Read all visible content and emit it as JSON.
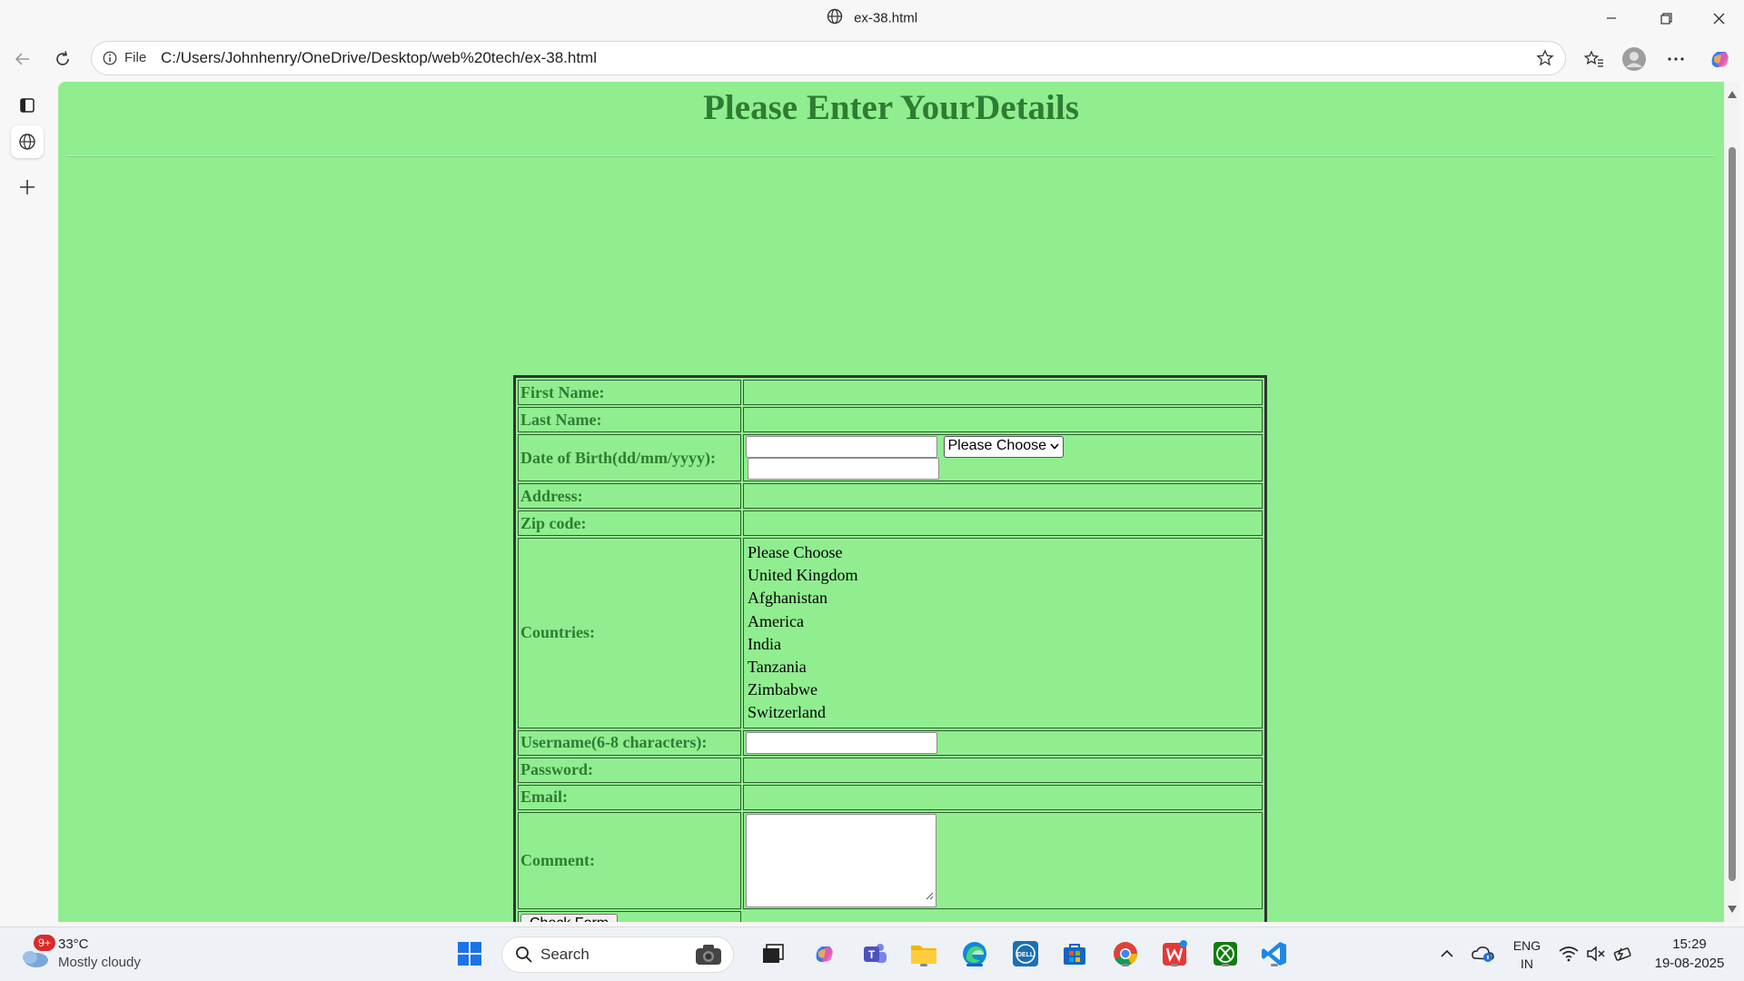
{
  "window": {
    "title": "ex-38.html"
  },
  "address_bar": {
    "protocol_label": "File",
    "url": "C:/Users/Johnhenry/OneDrive/Desktop/web%20tech/ex-38.html"
  },
  "page": {
    "heading": "Please Enter YourDetails",
    "form": {
      "first_name_label": "First Name:",
      "last_name_label": "Last Name:",
      "dob_label": "Date of Birth(dd/mm/yyyy):",
      "dob_month_selected": "Please Choose",
      "address_label": "Address:",
      "zip_label": "Zip code:",
      "countries_label": "Countries:",
      "countries": [
        "Please Choose",
        "United Kingdom",
        "Afghanistan",
        "America",
        "India",
        "Tanzania",
        "Zimbabwe",
        "Switzerland"
      ],
      "username_label": "Username(6-8 characters):",
      "password_label": "Password:",
      "email_label": "Email:",
      "comment_label": "Comment:",
      "submit_label": "Check Form"
    }
  },
  "taskbar": {
    "weather_badge": "9+",
    "weather_temp": "33°C",
    "weather_condition": "Mostly cloudy",
    "search_label": "Search",
    "language": "ENG",
    "region": "IN",
    "time": "15:29",
    "date": "19-08-2025"
  },
  "colors": {
    "page_background": "#90ee90",
    "heading": "#2e7d32",
    "labels": "#2e7d32"
  }
}
